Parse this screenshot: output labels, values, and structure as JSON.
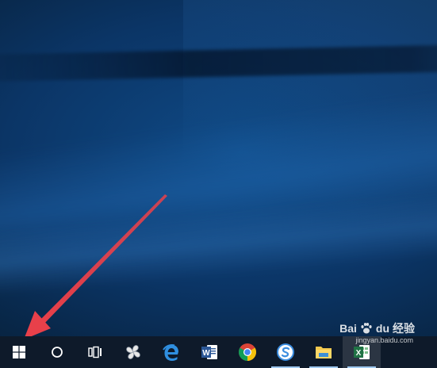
{
  "taskbar": {
    "items": [
      {
        "name": "start-button",
        "icon": "windows-logo-icon"
      },
      {
        "name": "search-button",
        "icon": "cortana-circle-icon"
      },
      {
        "name": "task-view-button",
        "icon": "task-view-icon"
      },
      {
        "name": "pinwheel-app-button",
        "icon": "pinwheel-icon"
      },
      {
        "name": "edge-button",
        "icon": "edge-e-icon"
      },
      {
        "name": "word-button",
        "icon": "word-icon"
      },
      {
        "name": "chrome-button",
        "icon": "chrome-icon"
      },
      {
        "name": "browser-s-button",
        "icon": "s-browser-icon"
      },
      {
        "name": "file-explorer-button",
        "icon": "folder-icon"
      },
      {
        "name": "excel-button",
        "icon": "excel-icon"
      }
    ],
    "accent": "#9ec8ef"
  },
  "annotation": {
    "arrow_color": "#e8404a"
  },
  "watermark": {
    "logo_text": "Bai",
    "logo_glyph": "du",
    "cn_text": "经验",
    "sub_text": "jingyan.baidu.com"
  }
}
